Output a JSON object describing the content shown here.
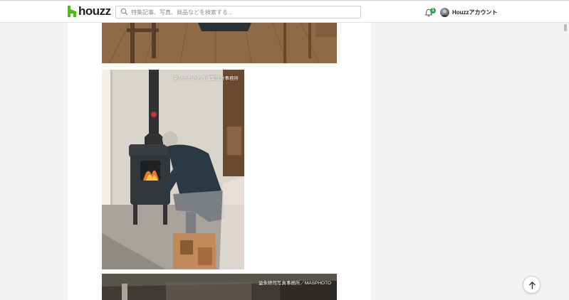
{
  "header": {
    "logo_text": "houzz",
    "search_placeholder": "特集記事、写真、商品などを検索する...",
    "notifications_count": "1",
    "account_label": "Houzzアカウント"
  },
  "photos": [
    {
      "credit": ""
    },
    {
      "credit": "あいかわさとう建築設計事務所"
    },
    {
      "credit": "益永研司写真事務所／MASPHOTO"
    }
  ],
  "icons": {
    "search": "search-icon",
    "bell": "bell-icon",
    "scroll_top": "arrow-up-icon"
  },
  "colors": {
    "brand_green": "#4dbc15",
    "badge_green": "#2ea043"
  }
}
